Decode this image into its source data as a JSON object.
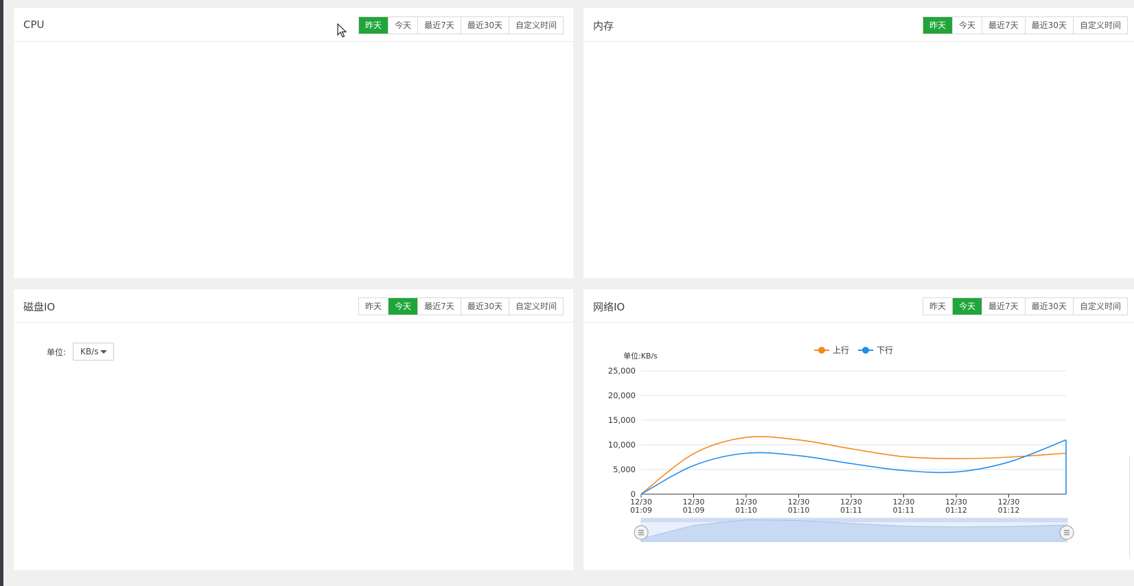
{
  "panels": {
    "cpu": {
      "title": "CPU",
      "buttons": [
        "昨天",
        "今天",
        "最近7天",
        "最近30天",
        "自定义时间"
      ],
      "active": "昨天"
    },
    "memory": {
      "title": "内存",
      "buttons": [
        "昨天",
        "今天",
        "最近7天",
        "最近30天",
        "自定义时间"
      ],
      "active": "昨天"
    },
    "disk": {
      "title": "磁盘IO",
      "buttons": [
        "昨天",
        "今天",
        "最近7天",
        "最近30天",
        "自定义时间"
      ],
      "active": "今天",
      "unit_label": "单位:",
      "unit_value": "KB/s"
    },
    "network": {
      "title": "网络IO",
      "buttons": [
        "昨天",
        "今天",
        "最近7天",
        "最近30天",
        "自定义时间"
      ],
      "active": "今天"
    }
  },
  "colors": {
    "accent_green": "#20a53a",
    "up_series": "#f5891c",
    "down_series": "#1e8ef0"
  },
  "chart_data": {
    "type": "line",
    "title": "",
    "ylabel": "单位:KB/s",
    "xlabel": "",
    "ylim": [
      0,
      25000
    ],
    "yticks": [
      "0",
      "5,000",
      "10,000",
      "15,000",
      "20,000",
      "25,000"
    ],
    "x": [
      "12/30 01:09",
      "12/30 01:09",
      "12/30 01:10",
      "12/30 01:10",
      "12/30 01:11",
      "12/30 01:11",
      "12/30 01:12",
      "12/30 01:12",
      ""
    ],
    "legend_position": "top-center",
    "grid": true,
    "series": [
      {
        "name": "上行",
        "values": [
          0,
          8200,
          11500,
          11000,
          9200,
          7600,
          7200,
          7500,
          8300
        ]
      },
      {
        "name": "下行",
        "values": [
          0,
          5800,
          8300,
          7800,
          6200,
          4800,
          4500,
          6500,
          11000
        ]
      }
    ]
  }
}
